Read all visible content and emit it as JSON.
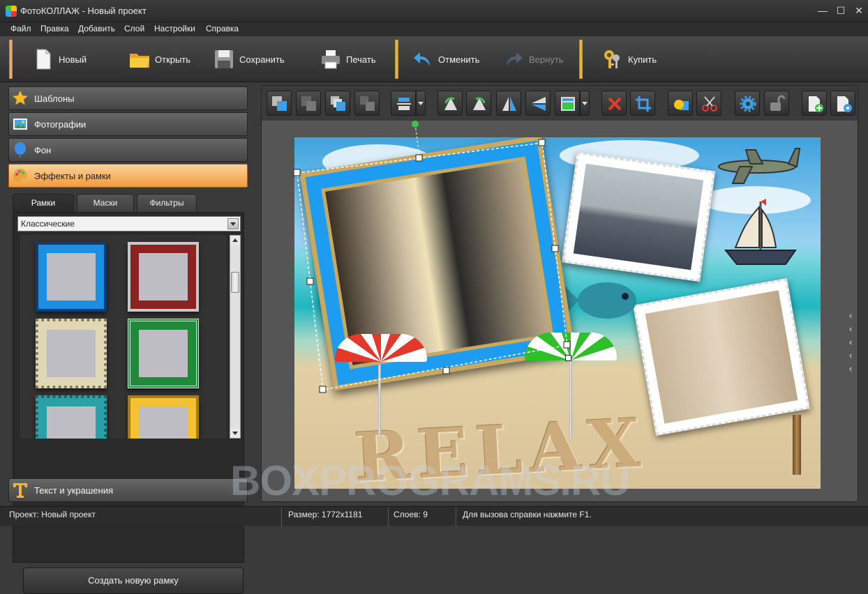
{
  "window": {
    "title": "ФотоКОЛЛАЖ - Новый проект",
    "min": "—",
    "max": "☐",
    "close": "✕"
  },
  "menu": [
    "Файл",
    "Правка",
    "Добавить",
    "Слой",
    "Настройки",
    "Справка"
  ],
  "toolbar": {
    "new": "Новый",
    "open": "Открыть",
    "save": "Сохранить",
    "print": "Печать",
    "undo": "Отменить",
    "redo": "Вернуть",
    "buy": "Купить"
  },
  "sidebar": {
    "sections": {
      "templates": "Шаблоны",
      "photos": "Фотографии",
      "background": "Фон",
      "effects": "Эффекты и рамки",
      "text": "Текст и украшения"
    },
    "tabs": {
      "frames": "Рамки",
      "masks": "Маски",
      "filters": "Фильтры"
    },
    "frame_category": "Классические",
    "frames": [
      {
        "outer": "#1e8fe0",
        "border": "#0b3d7a"
      },
      {
        "outer": "#8b2323",
        "border": "#c8c8c8"
      },
      {
        "outer": "#e0d8b4",
        "border": "#7a7458"
      },
      {
        "outer": "#1f8a3a",
        "border": "#e8e8e8"
      },
      {
        "outer": "#2aa0a8",
        "border": "#1a5c62"
      },
      {
        "outer": "#f2c230",
        "border": "#a87a10"
      }
    ],
    "create_button": "Создать новую рамку"
  },
  "collage": {
    "sand_text": "RELAX",
    "scroll_arrows": [
      "‹",
      "‹",
      "‹",
      "‹",
      "‹"
    ]
  },
  "watermark": "BOXPROGRAMS.RU",
  "status": {
    "project": "Проект:  Новый проект",
    "size": "Размер:  1772x1181",
    "layers": "Слоев:  9",
    "help": "Для вызова справки нажмите F1."
  },
  "colors": {
    "accent": "#f19b3b",
    "gold_separator": "#f0c27a",
    "delete": "#e83a2a"
  }
}
